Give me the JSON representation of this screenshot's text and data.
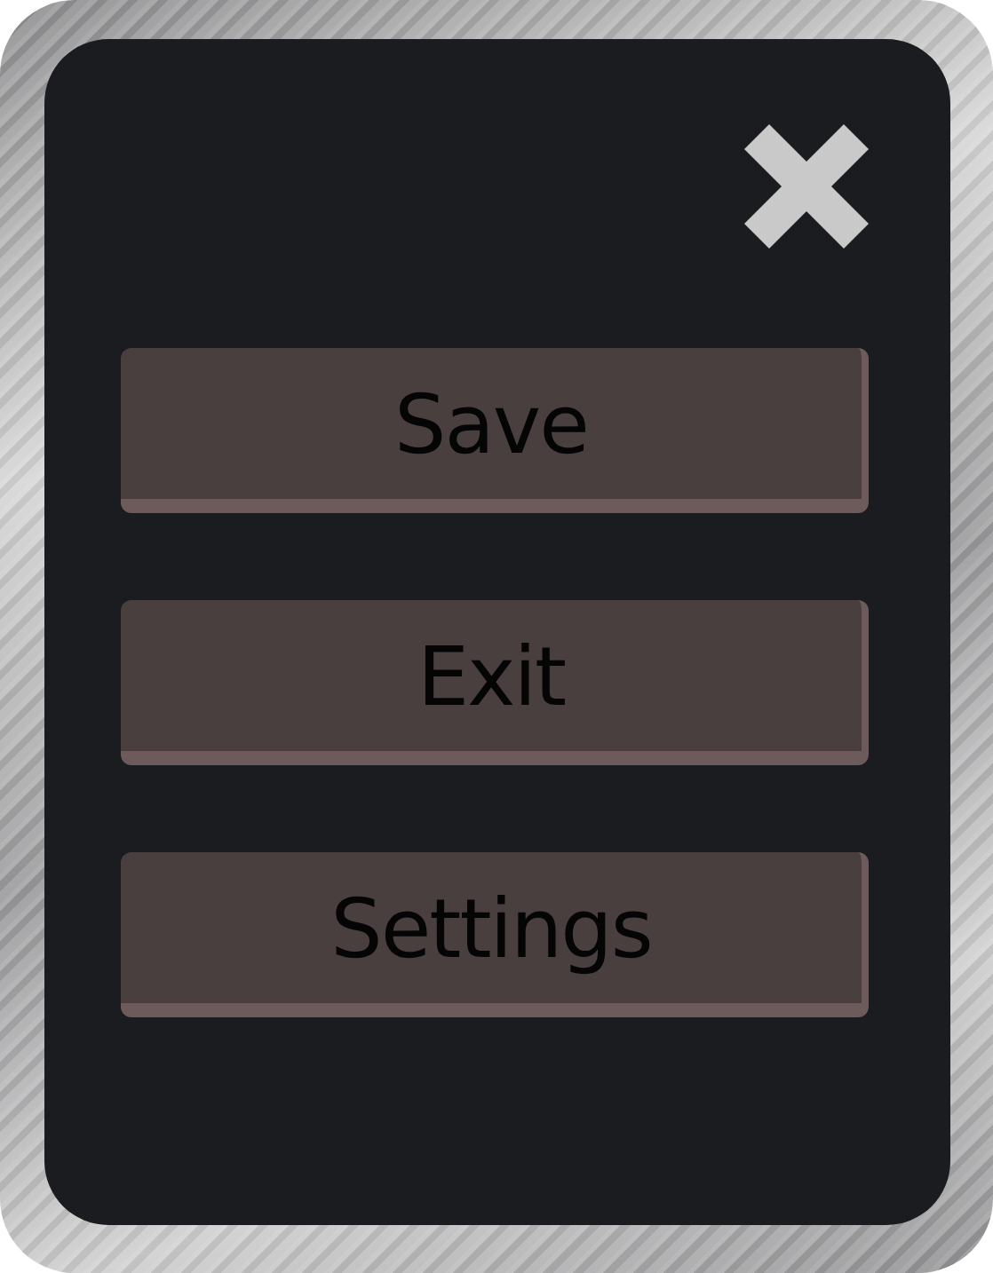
{
  "buttons": [
    {
      "label": "Save"
    },
    {
      "label": "Exit"
    },
    {
      "label": "Settings"
    }
  ]
}
